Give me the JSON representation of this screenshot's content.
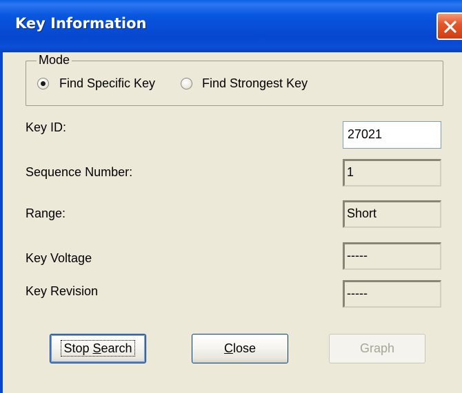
{
  "window": {
    "title": "Key Information"
  },
  "mode": {
    "label": "Mode",
    "options": [
      {
        "label": "Find Specific Key",
        "checked": true
      },
      {
        "label": "Find Strongest Key",
        "checked": false
      }
    ]
  },
  "fields": {
    "key_id": {
      "label": "Key ID:",
      "value": "27021"
    },
    "sequence_number": {
      "label": "Sequence Number:",
      "value": "1"
    },
    "range": {
      "label": "Range:",
      "value": "Short"
    },
    "key_voltage": {
      "label": "Key Voltage",
      "value": "-----"
    },
    "key_revision": {
      "label": "Key Revision",
      "value": "-----"
    }
  },
  "buttons": {
    "stop_search": {
      "pre": "Stop ",
      "accel": "S",
      "post": "earch"
    },
    "close": {
      "pre": "",
      "accel": "C",
      "post": "lose"
    },
    "graph": {
      "label": "Graph"
    }
  },
  "colors": {
    "titlebar": "#0a4fd6",
    "dialog_bg": "#ece9d8",
    "close_button": "#e4582c"
  }
}
